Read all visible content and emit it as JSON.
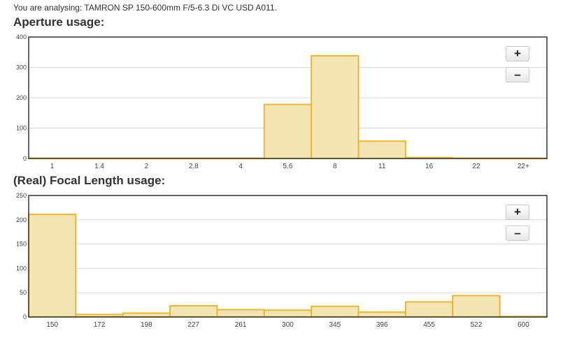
{
  "header": {
    "analysing_text": "You are analysing: TAMRON SP 150-600mm F/5-6.3 Di VC USD A011."
  },
  "sections": [
    {
      "title": "Aperture usage:",
      "zoom_in_label": "+",
      "zoom_out_label": "–"
    },
    {
      "title": "(Real) Focal Length usage:",
      "zoom_in_label": "+",
      "zoom_out_label": "–"
    }
  ],
  "colors": {
    "bar_fill": "#f5e4b3",
    "bar_stroke": "#e4b93a",
    "grid": "#d9d9d9",
    "axis": "#333333"
  },
  "chart_data": [
    {
      "type": "bar",
      "title": "Aperture usage:",
      "categories": [
        "1",
        "1.4",
        "2",
        "2.8",
        "4",
        "5.6",
        "8",
        "11",
        "16",
        "22",
        "22+"
      ],
      "values": [
        1,
        1,
        1,
        1,
        1,
        178,
        338,
        57,
        3,
        1,
        1
      ],
      "ylim": [
        0,
        400
      ],
      "yticks": [
        0,
        100,
        200,
        300,
        400
      ],
      "grid": true
    },
    {
      "type": "bar",
      "title": "(Real) Focal Length usage:",
      "categories": [
        "150",
        "172",
        "198",
        "227",
        "261",
        "300",
        "345",
        "396",
        "455",
        "522",
        "600"
      ],
      "values": [
        211,
        5,
        8,
        23,
        15,
        14,
        22,
        10,
        31,
        44,
        1
      ],
      "ylim": [
        0,
        250
      ],
      "yticks": [
        0,
        50,
        100,
        150,
        200,
        250
      ],
      "grid": true
    }
  ]
}
